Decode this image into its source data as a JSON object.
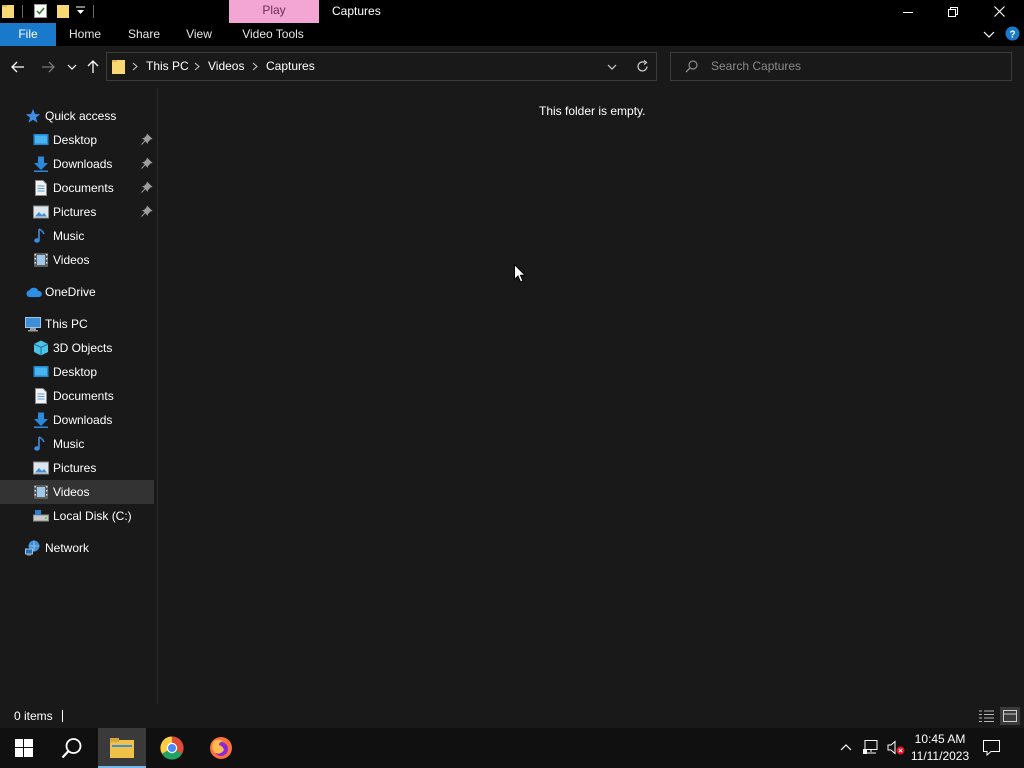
{
  "window": {
    "title": "Captures",
    "context_tab": "Play",
    "accent_color": "#1979ca",
    "context_tab_color": "#f3a6d3"
  },
  "ribbon": {
    "tabs": [
      {
        "label": "File",
        "icon": ""
      },
      {
        "label": "Home"
      },
      {
        "label": "Share"
      },
      {
        "label": "View"
      },
      {
        "label": "Video Tools"
      }
    ]
  },
  "address": {
    "breadcrumbs": [
      "This PC",
      "Videos",
      "Captures"
    ]
  },
  "search": {
    "placeholder": "Search Captures"
  },
  "navigation": {
    "quick_access": "Quick access",
    "quick_items": [
      {
        "label": "Desktop",
        "icon": "desktop-icon",
        "pinned": true
      },
      {
        "label": "Downloads",
        "icon": "downloads-icon",
        "pinned": true
      },
      {
        "label": "Documents",
        "icon": "documents-icon",
        "pinned": true
      },
      {
        "label": "Pictures",
        "icon": "pictures-icon",
        "pinned": true
      },
      {
        "label": "Music",
        "icon": "music-icon",
        "pinned": false
      },
      {
        "label": "Videos",
        "icon": "videos-icon",
        "pinned": false
      }
    ],
    "onedrive": "OneDrive",
    "this_pc": "This PC",
    "pc_items": [
      {
        "label": "3D Objects",
        "icon": "3d-objects-icon"
      },
      {
        "label": "Desktop",
        "icon": "desktop-icon"
      },
      {
        "label": "Documents",
        "icon": "documents-icon"
      },
      {
        "label": "Downloads",
        "icon": "downloads-icon"
      },
      {
        "label": "Music",
        "icon": "music-icon"
      },
      {
        "label": "Pictures",
        "icon": "pictures-icon"
      },
      {
        "label": "Videos",
        "icon": "videos-icon",
        "selected": true
      },
      {
        "label": "Local Disk (C:)",
        "icon": "local-disk-icon"
      }
    ],
    "network": "Network"
  },
  "content": {
    "empty_message": "This folder is empty."
  },
  "status": {
    "item_count": "0 items"
  },
  "taskbar": {
    "time": "10:45 AM",
    "date": "11/11/2023"
  }
}
